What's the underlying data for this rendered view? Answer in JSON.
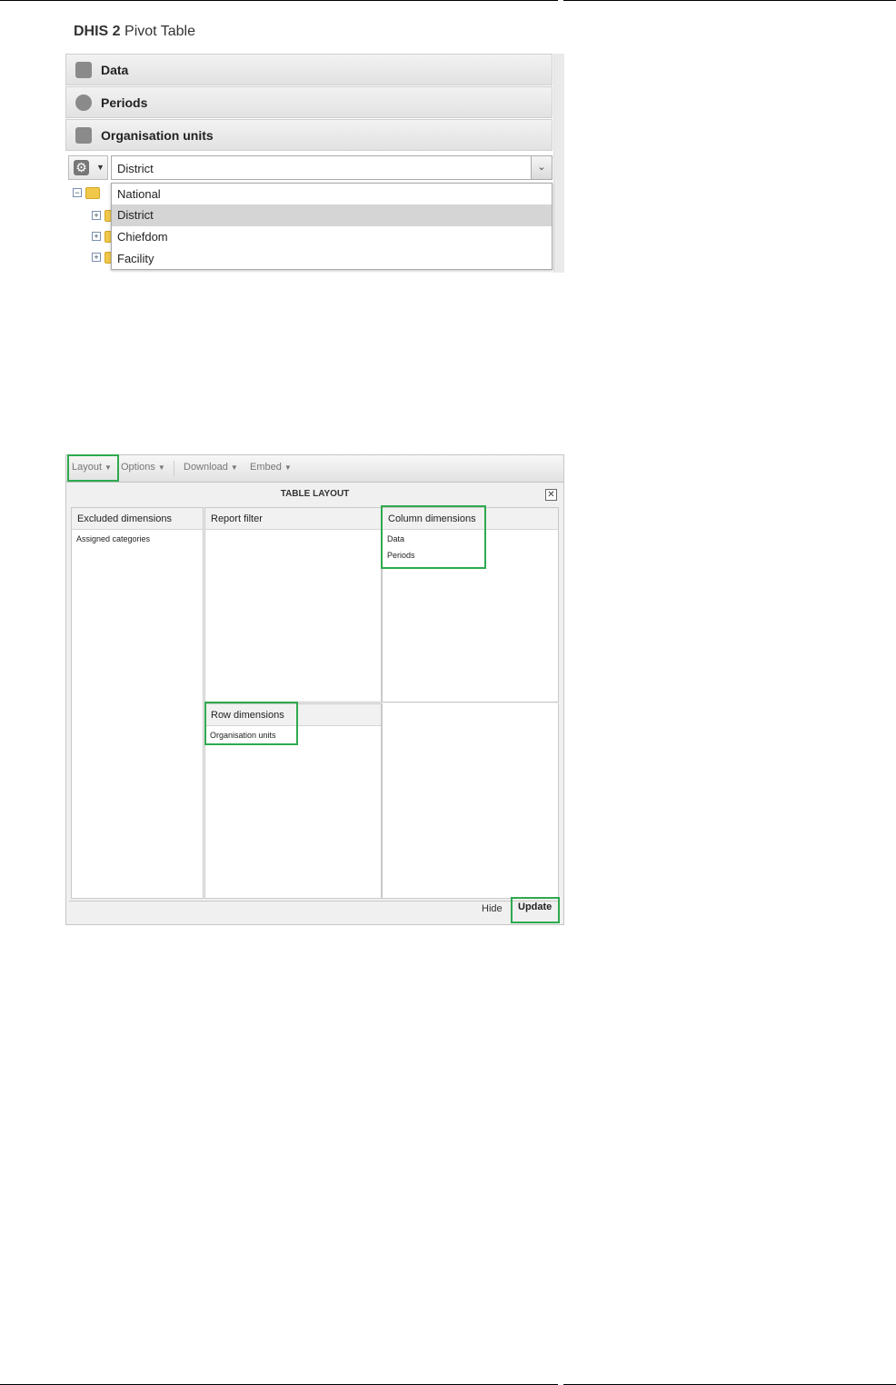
{
  "app": {
    "brand": "DHIS 2",
    "title": "Pivot Table"
  },
  "sections": [
    {
      "label": "Data",
      "icon": "data-icon"
    },
    {
      "label": "Periods",
      "icon": "clock-icon"
    },
    {
      "label": "Organisation units",
      "icon": "plus-icon"
    }
  ],
  "org_units": {
    "level_value": "District",
    "level_options": [
      "National",
      "District",
      "Chiefdom",
      "Facility"
    ],
    "selected_option": "District"
  },
  "toolbar": {
    "layout": "Layout",
    "options": "Options",
    "download": "Download",
    "embed": "Embed"
  },
  "table_layout": {
    "title": "TABLE LAYOUT",
    "excluded": {
      "header": "Excluded dimensions",
      "items": [
        "Assigned categories"
      ]
    },
    "report_filter": {
      "header": "Report filter",
      "items": []
    },
    "columns": {
      "header": "Column dimensions",
      "items": [
        "Data",
        "Periods"
      ]
    },
    "rows": {
      "header": "Row dimensions",
      "items": [
        "Organisation units"
      ]
    },
    "hide_label": "Hide",
    "update_label": "Update"
  },
  "colors": {
    "highlight": "#2eaa4e",
    "selected_row": "#d5d5d5"
  }
}
